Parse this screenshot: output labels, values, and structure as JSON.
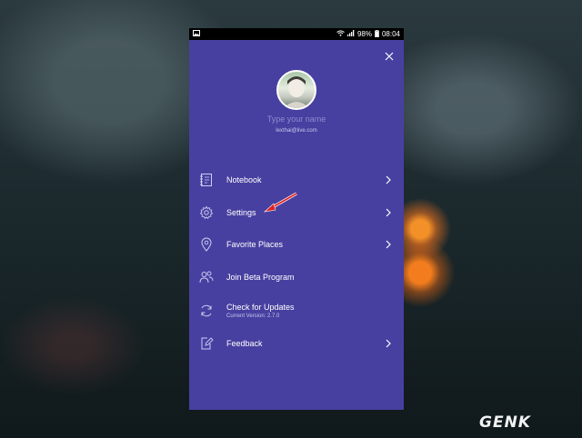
{
  "status_bar": {
    "battery": "98%",
    "time": "08:04"
  },
  "profile": {
    "name_placeholder": "Type your name",
    "email": "lexthai@live.com"
  },
  "menu": [
    {
      "label": "Notebook",
      "icon": "notebook-icon",
      "has_chevron": true
    },
    {
      "label": "Settings",
      "icon": "gear-icon",
      "has_chevron": true
    },
    {
      "label": "Favorite Places",
      "icon": "location-pin-icon",
      "has_chevron": true
    },
    {
      "label": "Join Beta Program",
      "icon": "users-icon",
      "has_chevron": false
    },
    {
      "label": "Check for Updates",
      "sublabel": "Current Version: 2.7.0",
      "icon": "refresh-icon",
      "has_chevron": false
    },
    {
      "label": "Feedback",
      "icon": "edit-icon",
      "has_chevron": true
    }
  ],
  "watermark": "GENK",
  "colors": {
    "drawer_bg": "#4840a0",
    "placeholder": "#8e8ad0",
    "annotation_arrow": "#e02020"
  }
}
